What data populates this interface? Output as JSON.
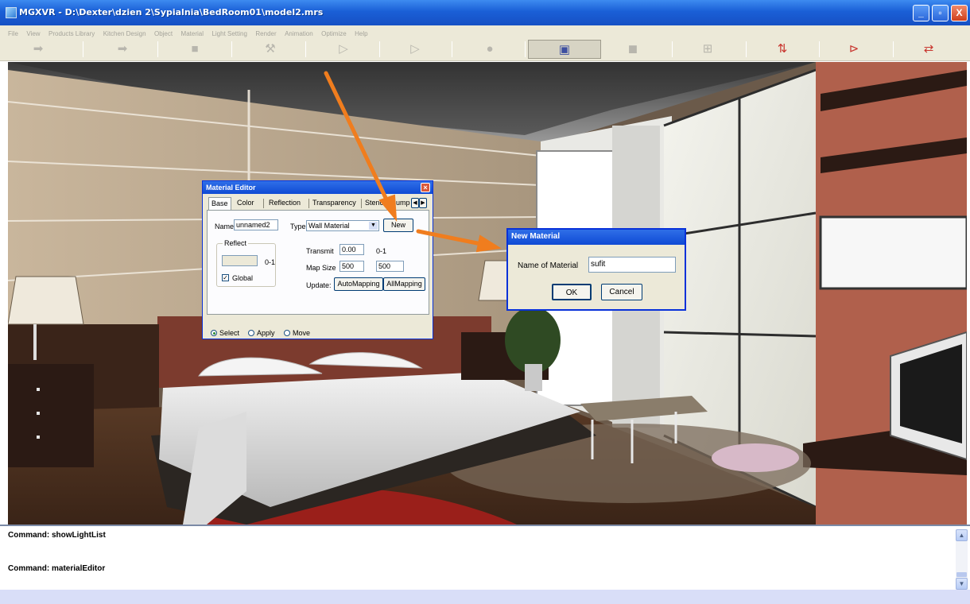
{
  "window": {
    "title": "MGXVR - D:\\Dexter\\dzien 2\\Sypialnia\\BedRoom01\\model2.mrs",
    "minimize_glyph": "_",
    "maximize_glyph": "▫",
    "close_glyph": "X"
  },
  "menu": [
    "File",
    "View",
    "Products Library",
    "Kitchen Design",
    "Object",
    "Material",
    "Light Setting",
    "Render",
    "Animation",
    "Optimize",
    "Help"
  ],
  "toolbar": {
    "icons": [
      {
        "name": "arrow-right-icon",
        "glyph": "➡"
      },
      {
        "name": "arrow-double-icon",
        "glyph": "➡"
      },
      {
        "name": "stop-square-icon",
        "glyph": "■"
      },
      {
        "name": "wand-icon",
        "glyph": "⚒"
      },
      {
        "name": "play-icon",
        "glyph": "▷"
      },
      {
        "name": "play-alt-icon",
        "glyph": "▷"
      },
      {
        "name": "sphere-icon",
        "glyph": "●"
      },
      {
        "name": "cube-active-icon",
        "glyph": "▣"
      },
      {
        "name": "cube-icon",
        "glyph": "◼"
      },
      {
        "name": "mesh-icon",
        "glyph": "⊞"
      },
      {
        "name": "swap-icon",
        "glyph": "⇅"
      },
      {
        "name": "forward-icon",
        "glyph": "⊳"
      },
      {
        "name": "refresh-icon",
        "glyph": "⇄"
      }
    ],
    "active_index": 7,
    "accent_red": "#c8352e"
  },
  "material_editor": {
    "title": "Material Editor",
    "tabs": [
      "Base",
      "Color",
      "Reflection",
      "Transparency",
      "Stencil",
      "Bump"
    ],
    "active_tab": "Base",
    "name_label": "Name",
    "name_value": "unnamed2",
    "type_label": "Type",
    "type_value": "Wall Material",
    "new_button": "New",
    "reflect_group": "Reflect",
    "reflect_range": "0-1",
    "transmit_label": "Transmit",
    "transmit_value": "0.00",
    "transmit_range": "0-1",
    "map_size_label": "Map Size",
    "map_size_w": "500",
    "map_size_h": "500",
    "global_label": "Global",
    "update_label": "Update:",
    "automapping_button": "AutoMapping",
    "allmapping_button": "AllMapping",
    "mode_select": "Select",
    "mode_apply": "Apply",
    "mode_move": "Move"
  },
  "new_material": {
    "title": "New Material",
    "name_label": "Name of Material",
    "name_value": "sufit",
    "ok_button": "OK",
    "cancel_button": "Cancel"
  },
  "console": {
    "lines": [
      "Command: showLightList",
      "Command: materialEditor"
    ]
  },
  "colors": {
    "titlebar": "#1a5fd6",
    "annotation_arrow": "#f07d1e",
    "dialog_border": "#0831d9"
  }
}
